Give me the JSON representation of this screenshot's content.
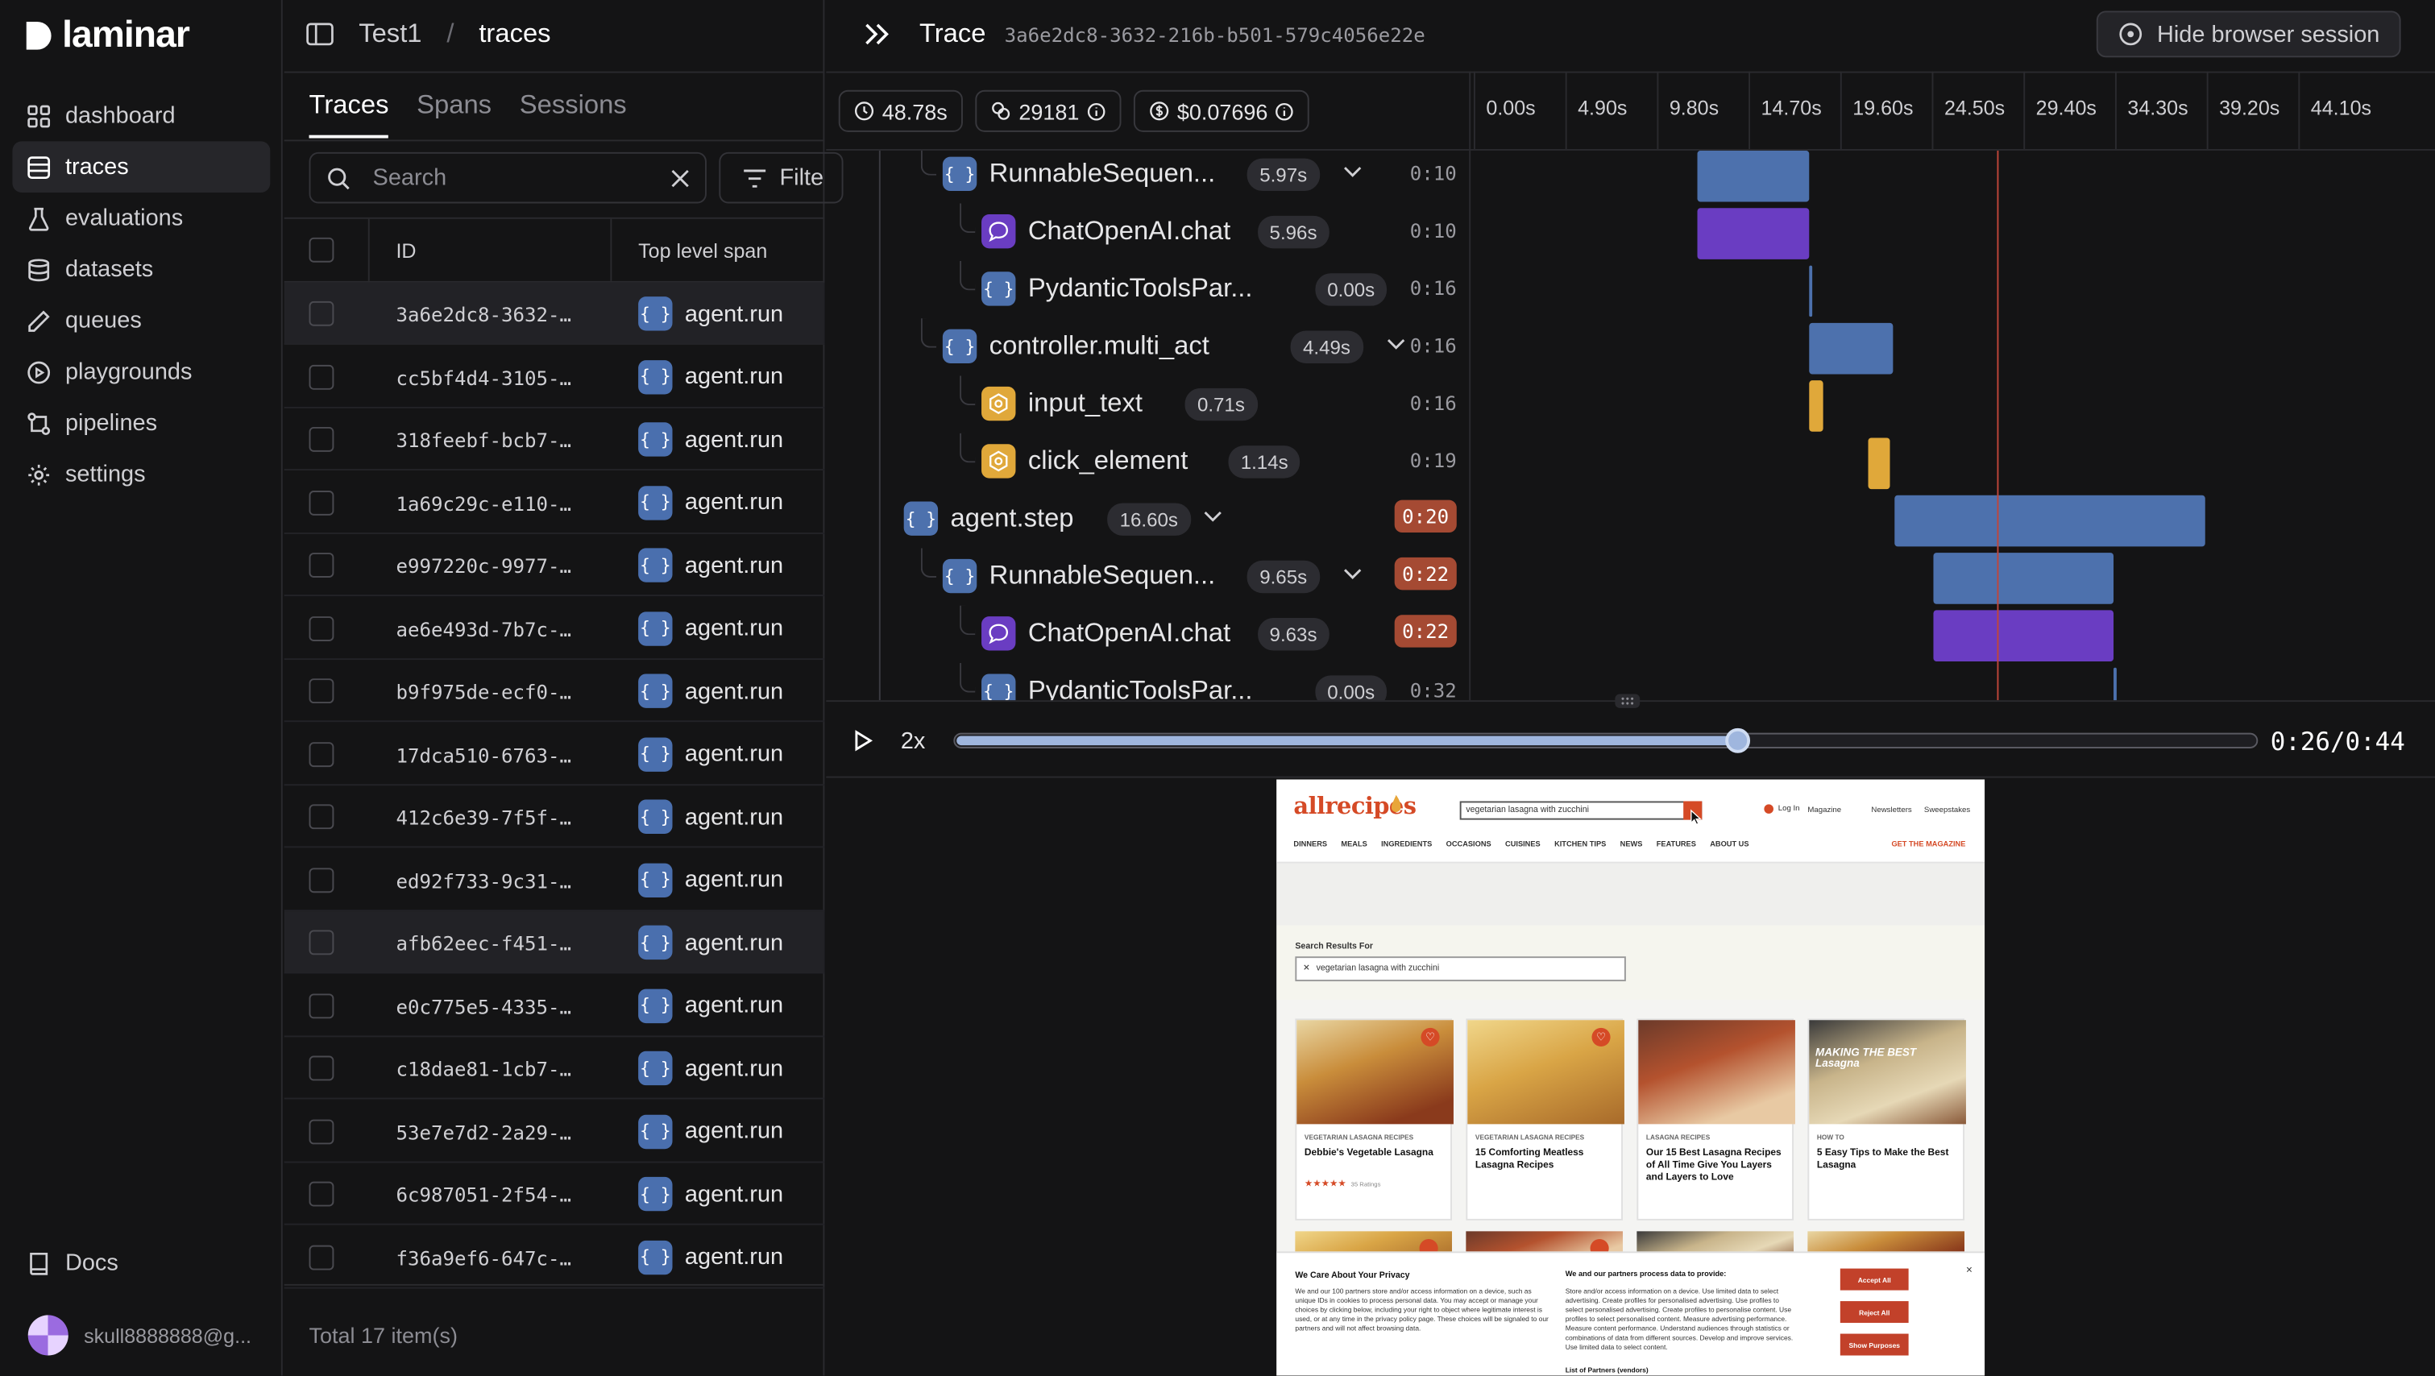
{
  "app": {
    "name": "laminar"
  },
  "sidebar": {
    "items": [
      {
        "label": "dashboard",
        "icon": "grid-icon"
      },
      {
        "label": "traces",
        "icon": "list-icon",
        "active": true
      },
      {
        "label": "evaluations",
        "icon": "flask-icon"
      },
      {
        "label": "datasets",
        "icon": "database-icon"
      },
      {
        "label": "queues",
        "icon": "pen-icon"
      },
      {
        "label": "playgrounds",
        "icon": "play-circle-icon"
      },
      {
        "label": "pipelines",
        "icon": "pipeline-icon"
      },
      {
        "label": "settings",
        "icon": "gear-icon"
      }
    ],
    "docs": "Docs",
    "user": "skull8888888@g..."
  },
  "header": {
    "project": "Test1",
    "separator": "/",
    "page": "traces"
  },
  "traces_panel": {
    "tabs": [
      "Traces",
      "Spans",
      "Sessions"
    ],
    "search_placeholder": "Search",
    "filter_label": "Filte",
    "columns": {
      "id": "ID",
      "top_span": "Top level span"
    },
    "rows": [
      {
        "id": "3a6e2dc8-3632-…",
        "span": "agent.run"
      },
      {
        "id": "cc5bf4d4-3105-…",
        "span": "agent.run"
      },
      {
        "id": "318feebf-bcb7-…",
        "span": "agent.run"
      },
      {
        "id": "1a69c29c-e110-…",
        "span": "agent.run"
      },
      {
        "id": "e997220c-9977-…",
        "span": "agent.run"
      },
      {
        "id": "ae6e493d-7b7c-…",
        "span": "agent.run"
      },
      {
        "id": "b9f975de-ecf0-…",
        "span": "agent.run"
      },
      {
        "id": "17dca510-6763-…",
        "span": "agent.run"
      },
      {
        "id": "412c6e39-7f5f-…",
        "span": "agent.run"
      },
      {
        "id": "ed92f733-9c31-…",
        "span": "agent.run"
      },
      {
        "id": "afb62eec-f451-…",
        "span": "agent.run"
      },
      {
        "id": "e0c775e5-4335-…",
        "span": "agent.run"
      },
      {
        "id": "c18dae81-1cb7-…",
        "span": "agent.run"
      },
      {
        "id": "53e7e7d2-2a29-…",
        "span": "agent.run"
      },
      {
        "id": "6c987051-2f54-…",
        "span": "agent.run"
      },
      {
        "id": "f36a9ef6-647c-…",
        "span": "agent.run"
      }
    ],
    "total": "Total 17 item(s)"
  },
  "trace": {
    "title": "Trace",
    "id": "3a6e2dc8-3632-216b-b501-579c4056e22e",
    "hide_session": "Hide browser session",
    "duration": "48.78s",
    "tokens": "29181",
    "cost": "$0.07696",
    "ticks": [
      "0.00s",
      "4.90s",
      "9.80s",
      "14.70s",
      "19.60s",
      "24.50s",
      "29.40s",
      "34.30s",
      "39.20s",
      "44.10s"
    ],
    "spans": [
      {
        "name": "RunnableSequen...",
        "duration": "5.97s",
        "time": "0:10",
        "type": "chain",
        "hot": false
      },
      {
        "name": "ChatOpenAI.chat",
        "duration": "5.96s",
        "time": "0:10",
        "type": "llm",
        "hot": false
      },
      {
        "name": "PydanticToolsPar...",
        "duration": "0.00s",
        "time": "0:16",
        "type": "chain",
        "hot": false
      },
      {
        "name": "controller.multi_act",
        "duration": "4.49s",
        "time": "0:16",
        "type": "chain",
        "hot": false
      },
      {
        "name": "input_text",
        "duration": "0.71s",
        "time": "0:16",
        "type": "tool",
        "hot": false
      },
      {
        "name": "click_element",
        "duration": "1.14s",
        "time": "0:19",
        "type": "tool",
        "hot": false
      },
      {
        "name": "agent.step",
        "duration": "16.60s",
        "time": "0:20",
        "type": "chain",
        "hot": true
      },
      {
        "name": "RunnableSequen...",
        "duration": "9.65s",
        "time": "0:22",
        "type": "chain",
        "hot": true
      },
      {
        "name": "ChatOpenAI.chat",
        "duration": "9.63s",
        "time": "0:22",
        "type": "llm",
        "hot": true
      },
      {
        "name": "PydanticToolsPar...",
        "duration": "0.00s",
        "time": "0:32",
        "type": "chain",
        "hot": false
      }
    ],
    "player": {
      "speed": "2x",
      "time": "0:26/0:44",
      "progress": 0.6
    }
  },
  "website": {
    "logo": "allrecipes",
    "search_value": "vegetarian lasagna with zucchini",
    "login": "Log In",
    "magazine": "Magazine",
    "newsletters": "Newsletters",
    "sweepstakes": "Sweepstakes",
    "nav": [
      "DINNERS",
      "MEALS",
      "INGREDIENTS",
      "OCCASIONS",
      "CUISINES",
      "KITCHEN TIPS",
      "NEWS",
      "FEATURES",
      "ABOUT US"
    ],
    "get_magazine": "GET THE MAGAZINE",
    "results_for": "Search Results For",
    "query": "vegetarian lasagna with zucchini",
    "cards": [
      {
        "category": "VEGETARIAN LASAGNA RECIPES",
        "title": "Debbie's Vegetable Lasagna",
        "ratings": "35 Ratings"
      },
      {
        "category": "VEGETARIAN LASAGNA RECIPES",
        "title": "15 Comforting Meatless Lasagna Recipes"
      },
      {
        "category": "LASAGNA RECIPES",
        "title": "Our 15 Best Lasagna Recipes of All Time Give You Layers and Layers to Love"
      },
      {
        "category": "HOW TO",
        "title": "5 Easy Tips to Make the Best Lasagna",
        "image_text": "MAKING THE BEST Lasagna"
      }
    ],
    "privacy": {
      "title": "We Care About Your Privacy",
      "body": "We and our 100 partners store and/or access information on a device, such as unique IDs in cookies to process personal data. You may accept or manage your choices by clicking below, including your right to object where legitimate interest is used, or at any time in the privacy policy page. These choices will be signaled to our partners and will not affect browsing data.",
      "process_title": "We and our partners process data to provide:",
      "process_body": "Store and/or access information on a device. Use limited data to select advertising. Create profiles for personalised advertising. Use profiles to select personalised advertising. Create profiles to personalise content. Use profiles to select personalised content. Measure advertising performance. Measure content performance. Understand audiences through statistics or combinations of data from different sources. Develop and improve services. Use limited data to select content.",
      "partners": "List of Partners (vendors)",
      "accept": "Accept All",
      "reject": "Reject All",
      "purposes": "Show Purposes"
    }
  },
  "colors": {
    "chain": "#4d71ad",
    "llm": "#6a3dc2",
    "tool": "#e0a83a",
    "hot": "#a54a33",
    "cursor": "#c0463a"
  }
}
